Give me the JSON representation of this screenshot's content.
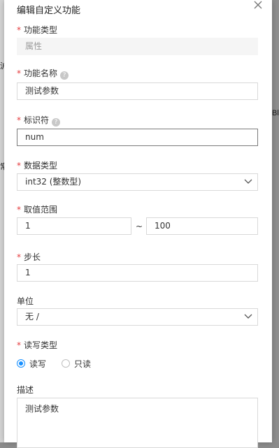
{
  "background": {
    "frag_left": "沪",
    "frag_right": "Bl",
    "frag_left_mid": "常"
  },
  "drawer": {
    "title": "编辑自定义功能",
    "required_mark": "*",
    "fields": {
      "func_type": {
        "label": "功能类型",
        "value": "属性"
      },
      "func_name": {
        "label": "功能名称",
        "value": "测试参数",
        "help": "?"
      },
      "identifier": {
        "label": "标识符",
        "value": "num",
        "help": "?"
      },
      "data_type": {
        "label": "数据类型",
        "value": "int32 (整数型)"
      },
      "range": {
        "label": "取值范围",
        "min": "1",
        "separator": "~",
        "max": "100"
      },
      "step": {
        "label": "步长",
        "value": "1"
      },
      "unit": {
        "label": "单位",
        "value": "无 /"
      },
      "rw_type": {
        "label": "读写类型",
        "options": [
          "读写",
          "只读"
        ],
        "selected": "读写"
      },
      "description": {
        "label": "描述",
        "value": "测试参数"
      }
    }
  },
  "colors": {
    "accent": "#1890ff",
    "required": "#e4393c"
  }
}
